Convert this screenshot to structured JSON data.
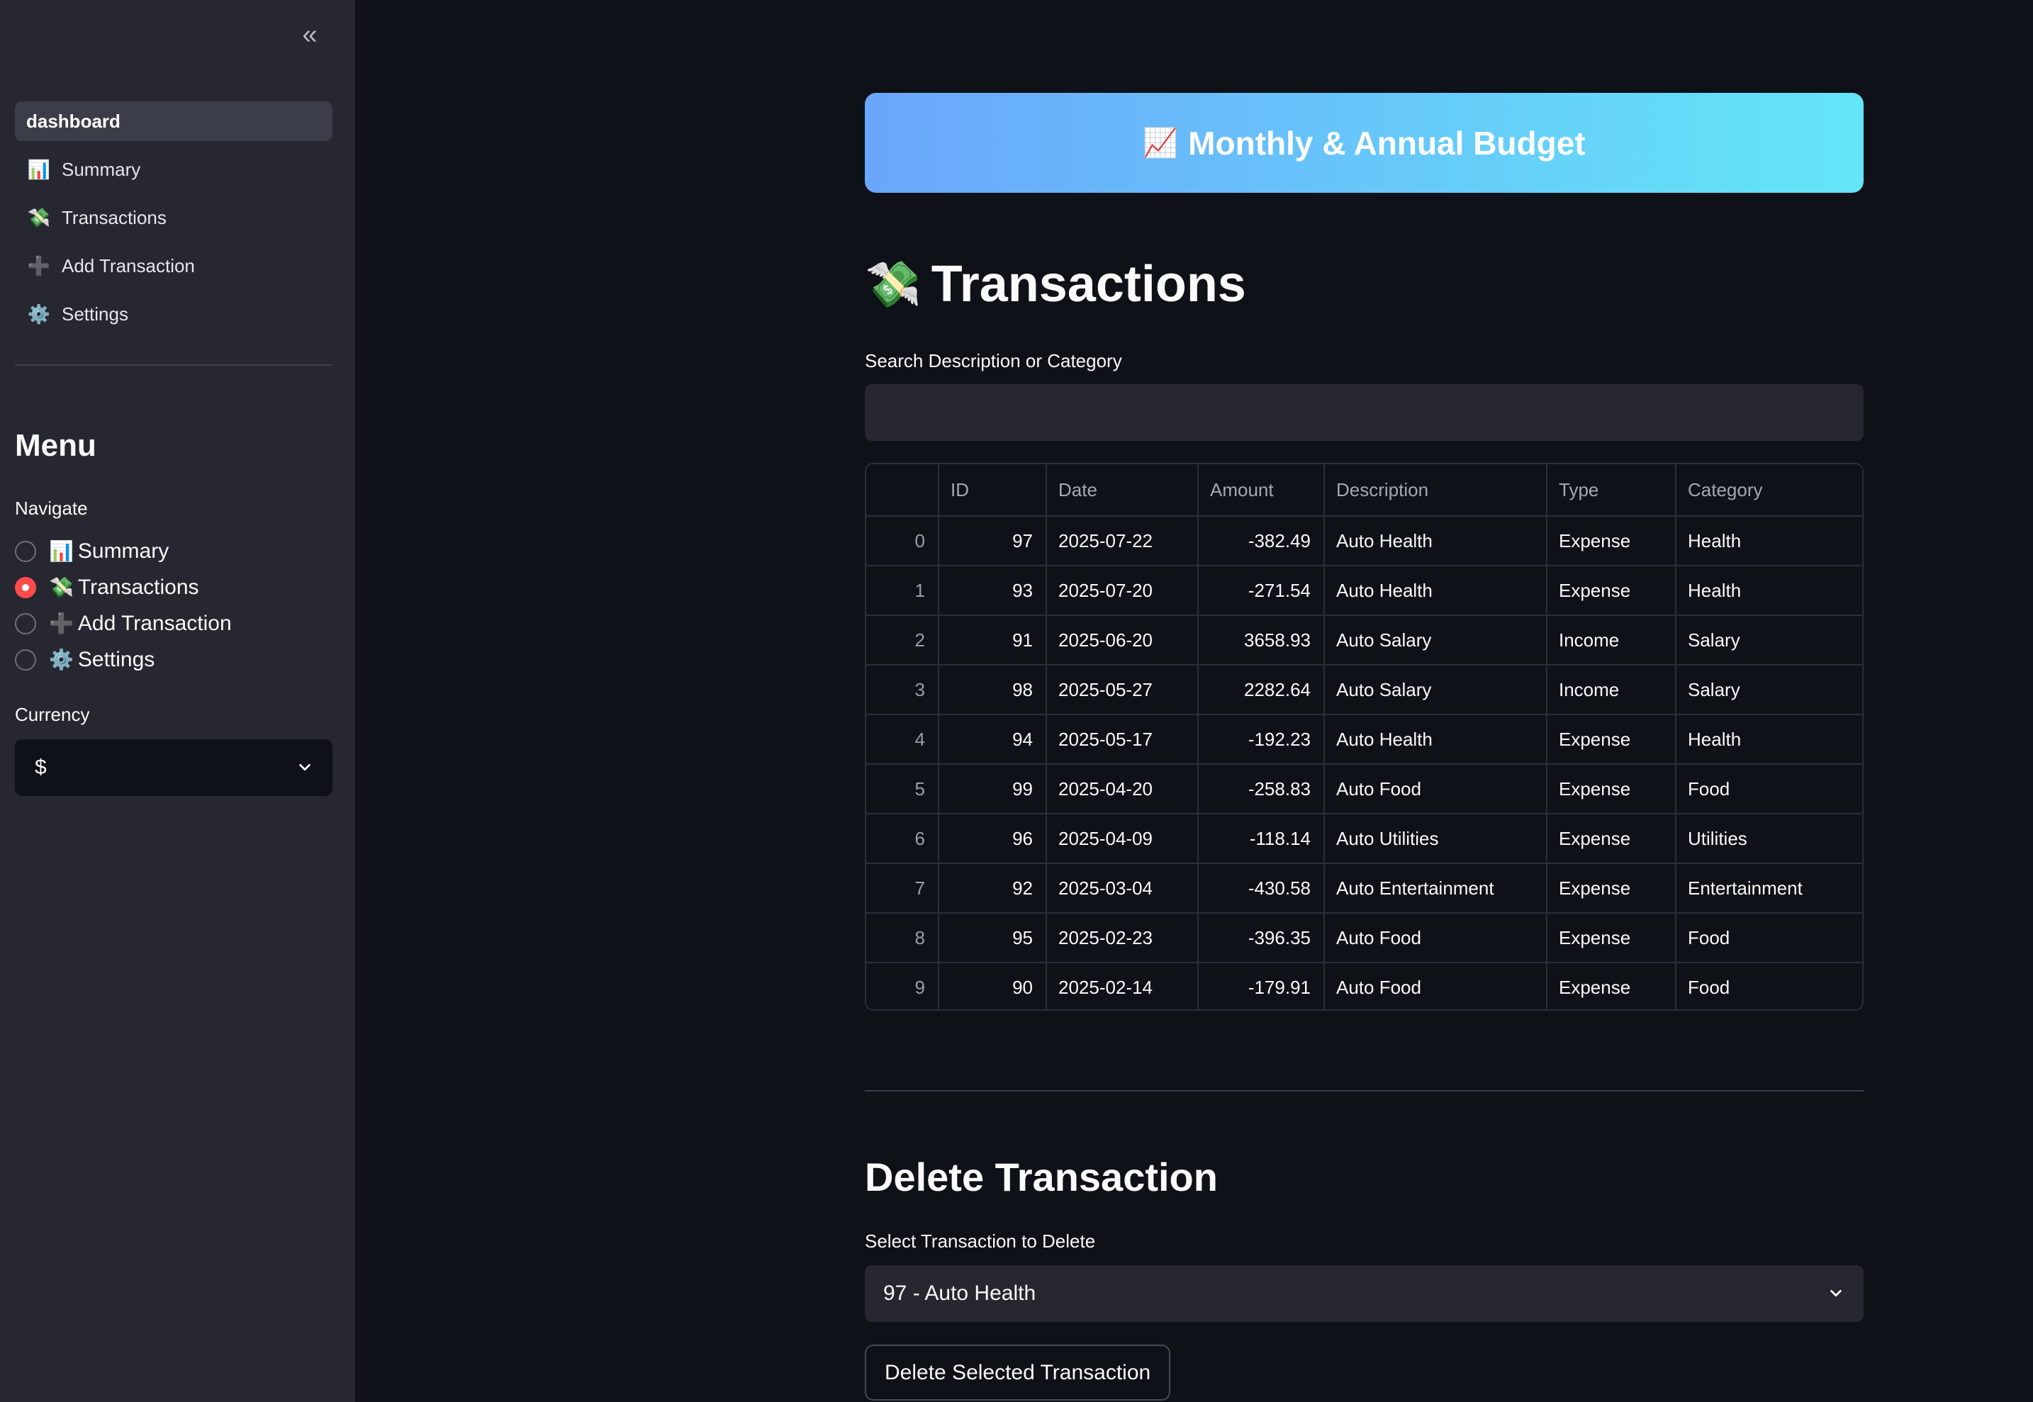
{
  "sidebar": {
    "collapse_icon": "double-chevron-left-icon",
    "pages": [
      {
        "label": "dashboard",
        "icon": "",
        "active": true
      },
      {
        "label": "Summary",
        "icon": "📊"
      },
      {
        "label": "Transactions",
        "icon": "💸"
      },
      {
        "label": "Add Transaction",
        "icon": "➕"
      },
      {
        "label": "Settings",
        "icon": "⚙️"
      }
    ],
    "menu_title": "Menu",
    "navigate_label": "Navigate",
    "radio_options": [
      {
        "emoji": "📊",
        "label": "Summary"
      },
      {
        "emoji": "💸",
        "label": "Transactions",
        "selected": true
      },
      {
        "emoji": "➕",
        "label": "Add Transaction"
      },
      {
        "emoji": "⚙️",
        "label": "Settings"
      }
    ],
    "currency_label": "Currency",
    "currency_value": "$"
  },
  "banner": {
    "emoji": "📈",
    "title": "Monthly & Annual Budget"
  },
  "main": {
    "title_emoji": "💸",
    "title": "Transactions",
    "search_label": "Search Description or Category",
    "search_value": "",
    "table": {
      "columns": [
        "",
        "ID",
        "Date",
        "Amount",
        "Description",
        "Type",
        "Category"
      ],
      "rows": [
        [
          "0",
          "97",
          "2025-07-22",
          "-382.49",
          "Auto Health",
          "Expense",
          "Health"
        ],
        [
          "1",
          "93",
          "2025-07-20",
          "-271.54",
          "Auto Health",
          "Expense",
          "Health"
        ],
        [
          "2",
          "91",
          "2025-06-20",
          "3658.93",
          "Auto Salary",
          "Income",
          "Salary"
        ],
        [
          "3",
          "98",
          "2025-05-27",
          "2282.64",
          "Auto Salary",
          "Income",
          "Salary"
        ],
        [
          "4",
          "94",
          "2025-05-17",
          "-192.23",
          "Auto Health",
          "Expense",
          "Health"
        ],
        [
          "5",
          "99",
          "2025-04-20",
          "-258.83",
          "Auto Food",
          "Expense",
          "Food"
        ],
        [
          "6",
          "96",
          "2025-04-09",
          "-118.14",
          "Auto Utilities",
          "Expense",
          "Utilities"
        ],
        [
          "7",
          "92",
          "2025-03-04",
          "-430.58",
          "Auto Entertainment",
          "Expense",
          "Entertainment"
        ],
        [
          "8",
          "95",
          "2025-02-23",
          "-396.35",
          "Auto Food",
          "Expense",
          "Food"
        ],
        [
          "9",
          "90",
          "2025-02-14",
          "-179.91",
          "Auto Food",
          "Expense",
          "Food"
        ]
      ]
    },
    "delete": {
      "section_title": "Delete Transaction",
      "select_label": "Select Transaction to Delete",
      "selected_value": "97 - Auto Health",
      "button_label": "Delete Selected Transaction"
    }
  },
  "colors": {
    "background": "#0e1117",
    "sidebar": "#262730",
    "accent": "#ff4b4b",
    "banner_start": "#6aa6fb",
    "banner_end": "#64e6f8"
  }
}
